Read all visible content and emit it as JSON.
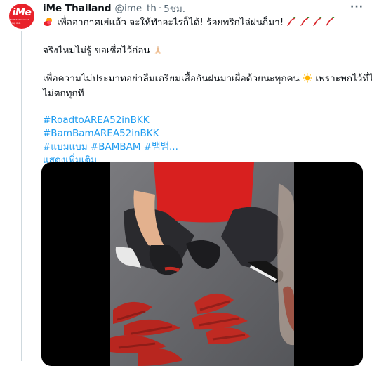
{
  "tweet": {
    "author_name": "iMe Thailand",
    "handle": "@ime_th",
    "separator": "·",
    "time": "5ชม.",
    "more_label": "···",
    "avatar_logo": "iMe",
    "avatar_logo_sub": "iMe Entertainment Group Asia",
    "lines": {
      "line1": "เพื่ออากาศเย่แล้ว จะให้ทำอะไรก็ได้! ร้อยพริกไล่ฝนก็มา!",
      "line2": "จริงไหมไม่รู้ ขอเชื่อไว้ก่อน",
      "line3a": "เพื่อความไม่ประมาทอย่าลืมเตรียมเสื้อกันฝนมาเผื่อด้วยนะทุกคน",
      "line3b": "เพราะพกไว้ที่ไรฝน",
      "line4": "ไม่ตกทุกที"
    },
    "hashtags": [
      "#RoadtoAREA52inBKK",
      "#BamBamAREA52inBKK"
    ],
    "hashtag_line3": "#แบมแบม #BAMBAM #뱀뱀...",
    "show_more": "แสดงเพิ่มเติม"
  },
  "icons": {
    "leading": "sun-behind-cloud-icon",
    "chili": "hot-pepper-icon",
    "pray": "folded-hands-icon",
    "sun": "sun-icon"
  },
  "colors": {
    "link": "#1d9bf0",
    "secondary_text": "#536471",
    "text": "#0f1419",
    "brand_red": "#e8222a"
  }
}
